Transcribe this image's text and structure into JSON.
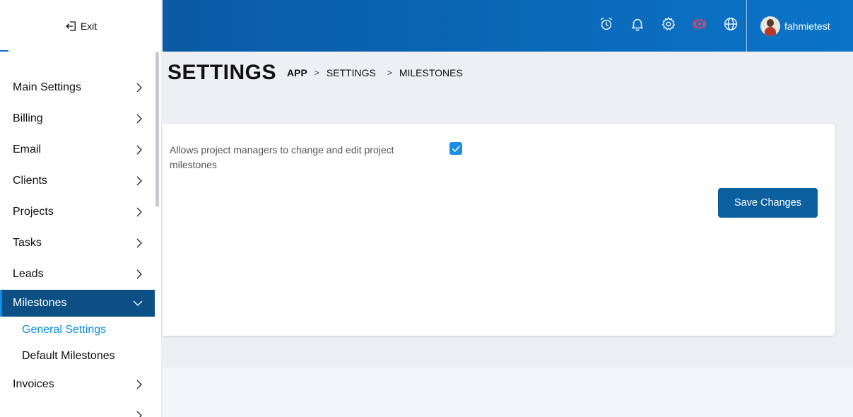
{
  "sidebar": {
    "exit_label": "Exit",
    "items": [
      {
        "label": "Main Settings"
      },
      {
        "label": "Billing"
      },
      {
        "label": "Email"
      },
      {
        "label": "Clients"
      },
      {
        "label": "Projects"
      },
      {
        "label": "Tasks"
      },
      {
        "label": "Leads"
      },
      {
        "label": "Milestones"
      },
      {
        "label": "Invoices"
      }
    ],
    "sub_items": [
      {
        "label": "General Settings"
      },
      {
        "label": "Default Milestones"
      }
    ]
  },
  "topbar": {
    "icons": [
      "alarm-clock-icon",
      "bell-icon",
      "gear-icon",
      "add-circle-icon",
      "globe-icon"
    ],
    "add_icon_color": "#f0445a",
    "username": "fahmietest"
  },
  "page": {
    "title": "SETTINGS",
    "breadcrumb": [
      "APP",
      "SETTINGS",
      "MILESTONES"
    ]
  },
  "settings_card": {
    "option_label": "Allows project managers to change and edit project milestones",
    "option_checked": true,
    "save_label": "Save Changes"
  },
  "colors": {
    "accent": "#0b4f85",
    "highlight": "#0a8ee8",
    "topbar": "#0b74c8"
  }
}
